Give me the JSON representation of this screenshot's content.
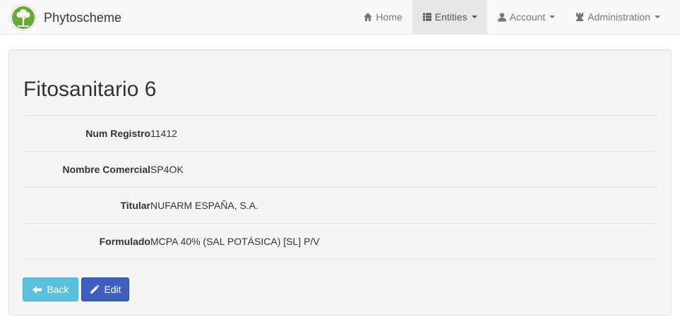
{
  "navbar": {
    "brand": "Phytoscheme",
    "items": [
      {
        "label": "Home",
        "icon": "home-icon",
        "has_caret": false
      },
      {
        "label": "Entities",
        "icon": "list-icon",
        "has_caret": true
      },
      {
        "label": "Account",
        "icon": "user-icon",
        "has_caret": true
      },
      {
        "label": "Administration",
        "icon": "tower-icon",
        "has_caret": true
      }
    ]
  },
  "page": {
    "title": "Fitosanitario 6",
    "fields": [
      {
        "label": "Num Registro",
        "value": "11412"
      },
      {
        "label": "Nombre Comercial",
        "value": "SP4OK"
      },
      {
        "label": "Titular",
        "value": "NUFARM ESPAÑA, S.A."
      },
      {
        "label": "Formulado",
        "value": "MCPA 40% (SAL POTÁSICA) [SL] P/V"
      }
    ]
  },
  "buttons": {
    "back": {
      "label": "Back",
      "icon": "arrow-left-icon"
    },
    "edit": {
      "label": "Edit",
      "icon": "pencil-icon"
    }
  },
  "colors": {
    "navbar_bg": "#f8f8f8",
    "active_tab_bg": "#e7e7e7",
    "back_button": "#5bc0de",
    "edit_button": "#3f5ebf",
    "logo_green": "#6aa83a"
  }
}
